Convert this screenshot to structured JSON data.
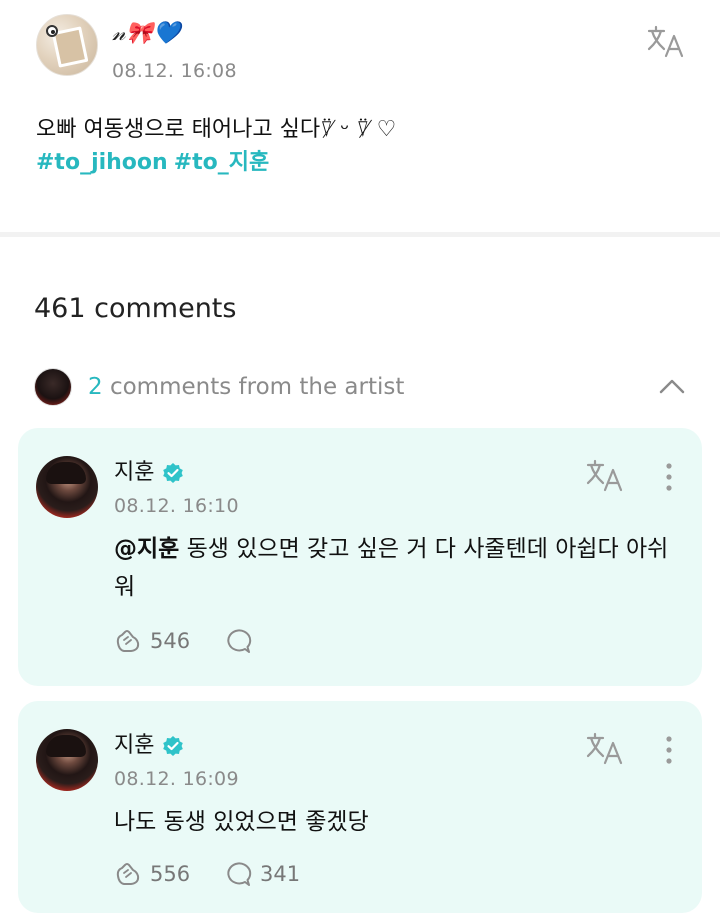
{
  "post": {
    "username": "𝓃🎀💙",
    "date": "08.12. 16:08",
    "body": "오빠 여동생으로 태어나고 싶다⍢̸ ᵕ ⍢̸ ♡",
    "hashtags": [
      "#to_jihoon",
      "#to_지훈"
    ],
    "icons": {
      "translate": "translate-icon"
    }
  },
  "comments_section": {
    "count_label": "461 comments",
    "artist_row": {
      "number": "2",
      "label": " comments from the artist",
      "icon": "chevron-up-icon"
    }
  },
  "comments": [
    {
      "name": "지훈",
      "date": "08.12. 16:10",
      "mention": "@지훈",
      "text": " 동생 있으면 갖고 싶은 거 다 사줄텐데 아쉽다 아쉬워",
      "likes": "546",
      "replies": ""
    },
    {
      "name": "지훈",
      "date": "08.12. 16:09",
      "mention": "",
      "text": "나도 동생 있었으면 좋겠당",
      "likes": "556",
      "replies": "341"
    }
  ],
  "colors": {
    "accent": "#27b8bf",
    "card_bg": "#eafaf7",
    "muted": "#8a8a8a"
  }
}
